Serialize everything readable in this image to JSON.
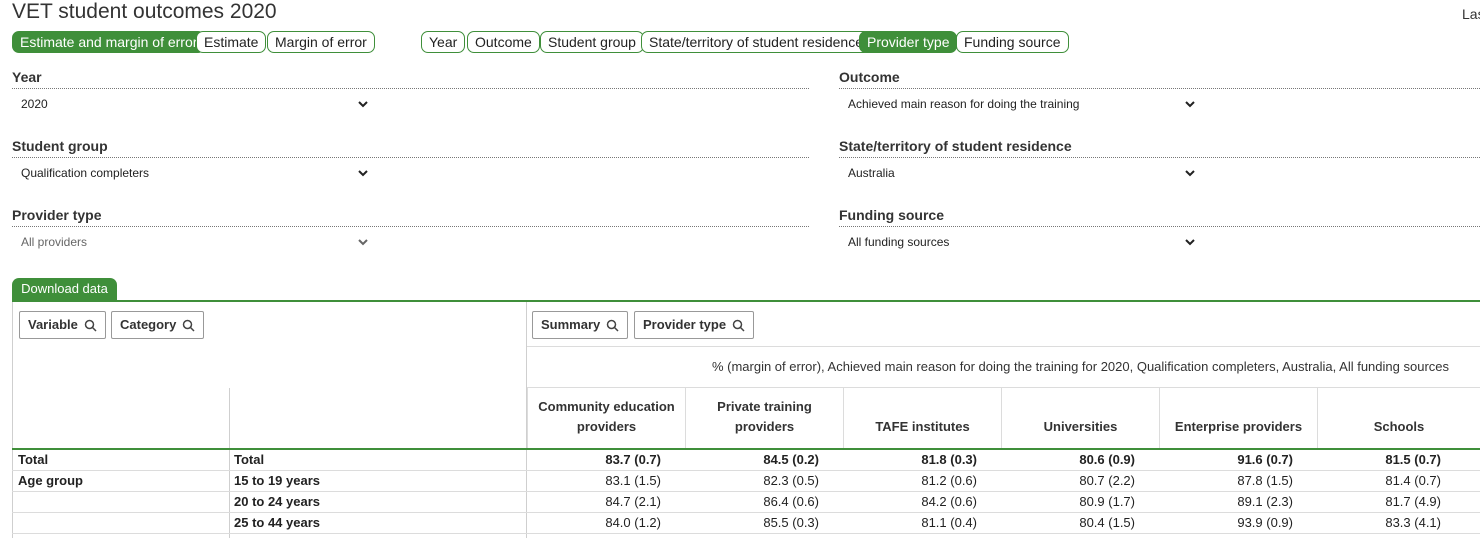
{
  "page": {
    "title": "VET student outcomes 2020",
    "top_right": "Las"
  },
  "display_toggles": [
    {
      "label": "Estimate and margin of error",
      "active": true
    },
    {
      "label": "Estimate",
      "active": false
    },
    {
      "label": "Margin of error",
      "active": false
    }
  ],
  "dimension_toggles": [
    {
      "label": "Year",
      "active": false
    },
    {
      "label": "Outcome",
      "active": false
    },
    {
      "label": "Student group",
      "active": false
    },
    {
      "label": "State/territory of student residence",
      "active": false
    },
    {
      "label": "Provider type",
      "active": true
    },
    {
      "label": "Funding source",
      "active": false
    }
  ],
  "filters": {
    "year": {
      "label": "Year",
      "value": "2020"
    },
    "outcome": {
      "label": "Outcome",
      "value": "Achieved main reason for doing the training"
    },
    "student_group": {
      "label": "Student group",
      "value": "Qualification completers"
    },
    "state": {
      "label": "State/territory of student residence",
      "value": "Australia"
    },
    "provider_type": {
      "label": "Provider type",
      "value": "All providers"
    },
    "funding_source": {
      "label": "Funding source",
      "value": "All funding sources"
    }
  },
  "download_label": "Download data",
  "table": {
    "row_filters": {
      "variable": "Variable",
      "category": "Category"
    },
    "col_filters": {
      "summary": "Summary",
      "provider_type": "Provider type"
    },
    "caption": "% (margin of error), Achieved main reason for doing the training for 2020, Qualification completers, Australia, All funding sources",
    "columns": [
      "Community education providers",
      "Private training providers",
      "TAFE institutes",
      "Universities",
      "Enterprise providers",
      "Schools"
    ],
    "rows": [
      {
        "variable": "Total",
        "category": "Total",
        "values": [
          "83.7 (0.7)",
          "84.5 (0.2)",
          "81.8 (0.3)",
          "80.6 (0.9)",
          "91.6 (0.7)",
          "81.5 (0.7)"
        ]
      },
      {
        "variable": "Age group",
        "category": "15 to 19 years",
        "values": [
          "83.1 (1.5)",
          "82.3 (0.5)",
          "81.2 (0.6)",
          "80.7 (2.2)",
          "87.8 (1.5)",
          "81.4 (0.7)"
        ]
      },
      {
        "variable": "",
        "category": "20 to 24 years",
        "values": [
          "84.7 (2.1)",
          "86.4 (0.6)",
          "84.2 (0.6)",
          "80.9 (1.7)",
          "89.1 (2.3)",
          "81.7 (4.9)"
        ]
      },
      {
        "variable": "",
        "category": "25 to 44 years",
        "values": [
          "84.0 (1.2)",
          "85.5 (0.3)",
          "81.1 (0.4)",
          "80.4 (1.5)",
          "93.9 (0.9)",
          "83.3 (4.1)"
        ]
      }
    ]
  }
}
